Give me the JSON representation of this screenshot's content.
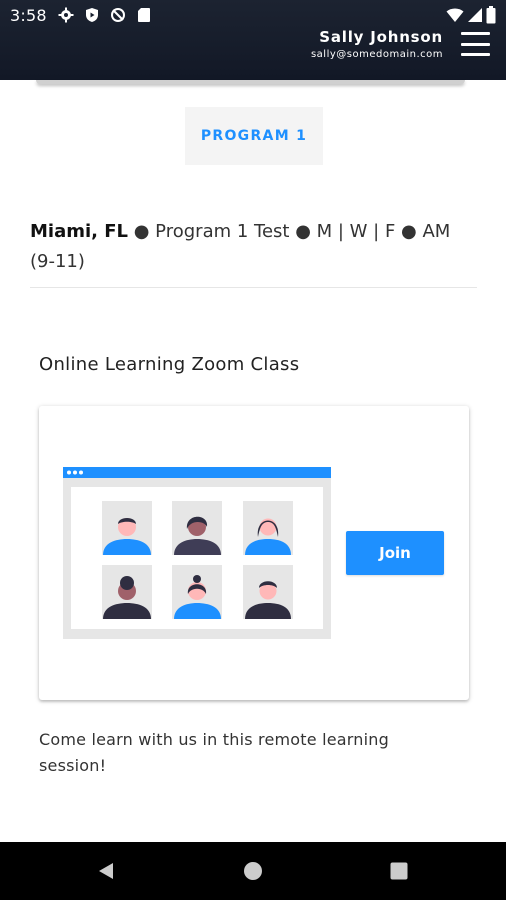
{
  "status_bar": {
    "time": "3:58",
    "icons_left": [
      "gear-icon",
      "play-protect-icon",
      "no-sync-icon",
      "sd-card-icon"
    ],
    "icons_right": [
      "wifi-icon",
      "signal-icon",
      "battery-icon"
    ]
  },
  "header": {
    "user_name": "Sally Johnson",
    "user_email": "sally@somedomain.com"
  },
  "program_tab": {
    "label": "PROGRAM 1"
  },
  "program_info": {
    "city": "Miami, FL",
    "details": " ● Program 1 Test ● M | W | F ● AM (9-11)"
  },
  "section": {
    "title": "Online Learning Zoom Class"
  },
  "class_card": {
    "join_label": "Join"
  },
  "description": "Come learn with us in this remote learning session!",
  "nav": {
    "buttons": [
      "back",
      "home",
      "recents"
    ]
  },
  "colors": {
    "accent": "#1e90ff",
    "header_bg": "#1a2130",
    "tab_bg": "#f4f4f4"
  }
}
